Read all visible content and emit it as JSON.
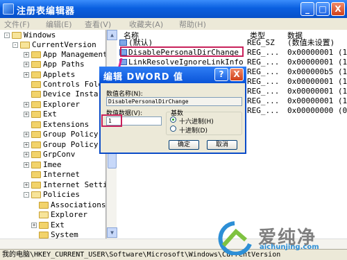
{
  "window": {
    "title": "注册表编辑器"
  },
  "title_buttons": {
    "minimize": "_",
    "maximize": "□",
    "close": "X"
  },
  "menu": [
    "文件(F)",
    "编辑(E)",
    "查看(V)",
    "收藏夹(A)",
    "帮助(H)"
  ],
  "tree": [
    {
      "label": "Windows",
      "expander": "-",
      "depth": 0
    },
    {
      "label": "CurrentVersion",
      "expander": "-",
      "depth": 1
    },
    {
      "label": "App Management",
      "expander": "+",
      "depth": 2
    },
    {
      "label": "App Paths",
      "expander": "+",
      "depth": 2
    },
    {
      "label": "Applets",
      "expander": "+",
      "depth": 2
    },
    {
      "label": "Controls Fold",
      "expander": "",
      "depth": 2
    },
    {
      "label": "Device Insta",
      "expander": "",
      "depth": 2
    },
    {
      "label": "Explorer",
      "expander": "+",
      "depth": 2
    },
    {
      "label": "Ext",
      "expander": "+",
      "depth": 2
    },
    {
      "label": "Extensions",
      "expander": "",
      "depth": 2
    },
    {
      "label": "Group Policy",
      "expander": "+",
      "depth": 2
    },
    {
      "label": "Group Policy",
      "expander": "+",
      "depth": 2
    },
    {
      "label": "GrpConv",
      "expander": "+",
      "depth": 2
    },
    {
      "label": "Imee",
      "expander": "+",
      "depth": 2
    },
    {
      "label": "Internet",
      "expander": "",
      "depth": 2
    },
    {
      "label": "Internet Setti",
      "expander": "+",
      "depth": 2
    },
    {
      "label": "Policies",
      "expander": "-",
      "depth": 2
    },
    {
      "label": "Associations",
      "expander": "",
      "depth": 3
    },
    {
      "label": "Explorer",
      "expander": "",
      "depth": 3
    },
    {
      "label": "Ext",
      "expander": "+",
      "depth": 3
    },
    {
      "label": "System",
      "expander": "",
      "depth": 3
    }
  ],
  "list": {
    "headers": {
      "name": "名称",
      "type": "类型",
      "data": "数据"
    },
    "rows": [
      {
        "name": "(默认)",
        "type": "REG_SZ",
        "data": "(数值未设置)"
      },
      {
        "name": "DisablePersonalDirChange",
        "type": "REG_...",
        "data": "0x00000001 (1"
      },
      {
        "name": "LinkResolveIgnoreLinkInfo",
        "type": "REG_...",
        "data": "0x00000001 (1"
      },
      {
        "name": "",
        "type": "REG_...",
        "data": "0x000000b5 (1"
      },
      {
        "name": "",
        "type": "REG_...",
        "data": "0x00000001 (1"
      },
      {
        "name": "",
        "type": "REG_...",
        "data": "0x00000001 (1"
      },
      {
        "name": "",
        "type": "REG_...",
        "data": "0x00000001 (1"
      },
      {
        "name": "",
        "type": "REG_...",
        "data": "0x00000000 (0"
      }
    ]
  },
  "dialog": {
    "title": "编辑 DWORD 值",
    "help_btn": "?",
    "close_btn": "X",
    "name_label": "数值名称(N):",
    "name_value": "DisablePersonalDirChange",
    "data_label": "数值数据(V):",
    "data_value": "1",
    "base_label": "基数",
    "radio_hex": "十六进制(H)",
    "radio_dec": "十进制(D)",
    "ok": "确定",
    "cancel": "取消"
  },
  "statusbar": {
    "path": "我的电脑\\HKEY_CURRENT_USER\\Software\\Microsoft\\Windows\\CurrentVersion"
  },
  "watermark": {
    "text": "爱纯净",
    "url": "aichunjing.com"
  },
  "colors": {
    "titlebar": "#0a5fe0",
    "highlight": "#c8205a",
    "watermark_url": "#2d8fd6"
  }
}
